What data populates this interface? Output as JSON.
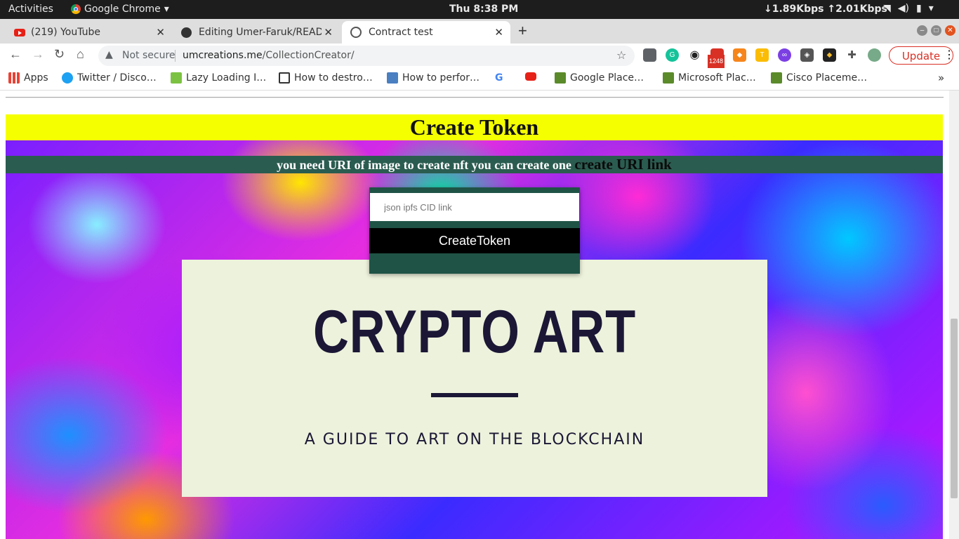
{
  "system": {
    "activities": "Activities",
    "app_name": "Google Chrome",
    "clock": "Thu  8:38 PM",
    "net_speed": "↓1.89Kbps ↑2.01Kbps"
  },
  "browser": {
    "tabs": [
      {
        "label": "(219) YouTube",
        "icon": "youtube-icon"
      },
      {
        "label": "Editing Umer-Faruk/READ",
        "icon": "github-icon"
      },
      {
        "label": "Contract test",
        "icon": "globe-icon"
      }
    ],
    "security": "Not secure",
    "url_host": "umcreations.me",
    "url_path": "/CollectionCreator/",
    "update_label": "Update",
    "ext_badge": "1248",
    "bookmarks": [
      {
        "label": "Apps",
        "icon": "apps-grid-icon"
      },
      {
        "label": "Twitter / Disco…",
        "icon": "twitter-icon"
      },
      {
        "label": "Lazy Loading I…",
        "icon": "bookmark-icon"
      },
      {
        "label": "How to destro…",
        "icon": "unity-icon"
      },
      {
        "label": "How to perfor…",
        "icon": "bookmark-icon"
      },
      {
        "label": "",
        "icon": "google-icon"
      },
      {
        "label": "",
        "icon": "youtube-icon"
      },
      {
        "label": "Google Place…",
        "icon": "bookmark-icon"
      },
      {
        "label": "Microsoft Plac…",
        "icon": "bookmark-icon"
      },
      {
        "label": "Cisco Placeme…",
        "icon": "bookmark-icon"
      }
    ]
  },
  "page": {
    "title": "Create Token",
    "info_text": "you need URI of image to create nft you can create one ",
    "info_link": "create URI link",
    "input_placeholder": "json ipfs CID link",
    "button_label": "CreateToken",
    "art_title": "CRYPTO ART",
    "art_subtitle": "A GUIDE TO ART ON THE BLOCKCHAIN"
  },
  "colors": {
    "header_bg": "#f5ff00",
    "info_bar_bg": "#2b5c50",
    "form_panel_bg": "#1f5346",
    "card_bg": "#edf2dc",
    "art_text": "#1b1735",
    "update_accent": "#d93025"
  }
}
